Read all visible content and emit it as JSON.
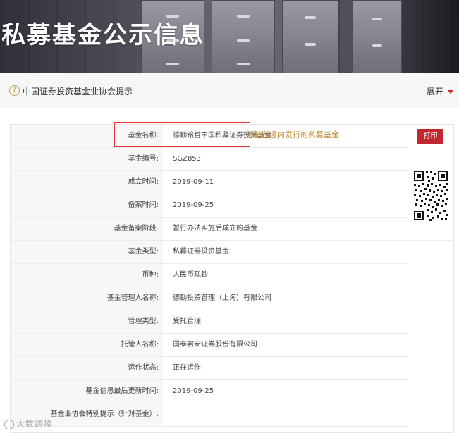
{
  "hero": {
    "title": "私募基金公示信息"
  },
  "notice": {
    "icon": "question-circle-icon",
    "text": "中国证券投资基金业协会提示",
    "expand_label": "展开"
  },
  "actions": {
    "print_label": "打印"
  },
  "annotation": {
    "note": "德勤在境内发行的私募基金",
    "box_color": "#e23a3a",
    "note_color": "#c48a2e"
  },
  "fund_info": [
    {
      "label": "基金名称:",
      "value": "德勤铭哲中国私募证券投资基金"
    },
    {
      "label": "基金编号:",
      "value": "SGZ853"
    },
    {
      "label": "成立时间:",
      "value": "2019-09-11"
    },
    {
      "label": "备案时间:",
      "value": "2019-09-25"
    },
    {
      "label": "基金备案阶段:",
      "value": "暂行办法实施后成立的基金"
    },
    {
      "label": "基金类型:",
      "value": "私募证券投资基金"
    },
    {
      "label": "币种:",
      "value": "人民币现钞"
    },
    {
      "label": "基金管理人名称:",
      "value": "德勤投资管理（上海）有限公司"
    },
    {
      "label": "管理类型:",
      "value": "受托管理"
    },
    {
      "label": "托管人名称:",
      "value": "国泰君安证券股份有限公司"
    },
    {
      "label": "运作状态:",
      "value": "正在运作"
    },
    {
      "label": "基金信息最后更新时间:",
      "value": "2019-09-25"
    },
    {
      "label": "基金业协会特别提示（针对基金）:",
      "value": ""
    }
  ],
  "watermark": {
    "text": "大数跨境"
  },
  "colors": {
    "accent_red": "#c0282d",
    "notice_icon": "#c8a25c"
  }
}
